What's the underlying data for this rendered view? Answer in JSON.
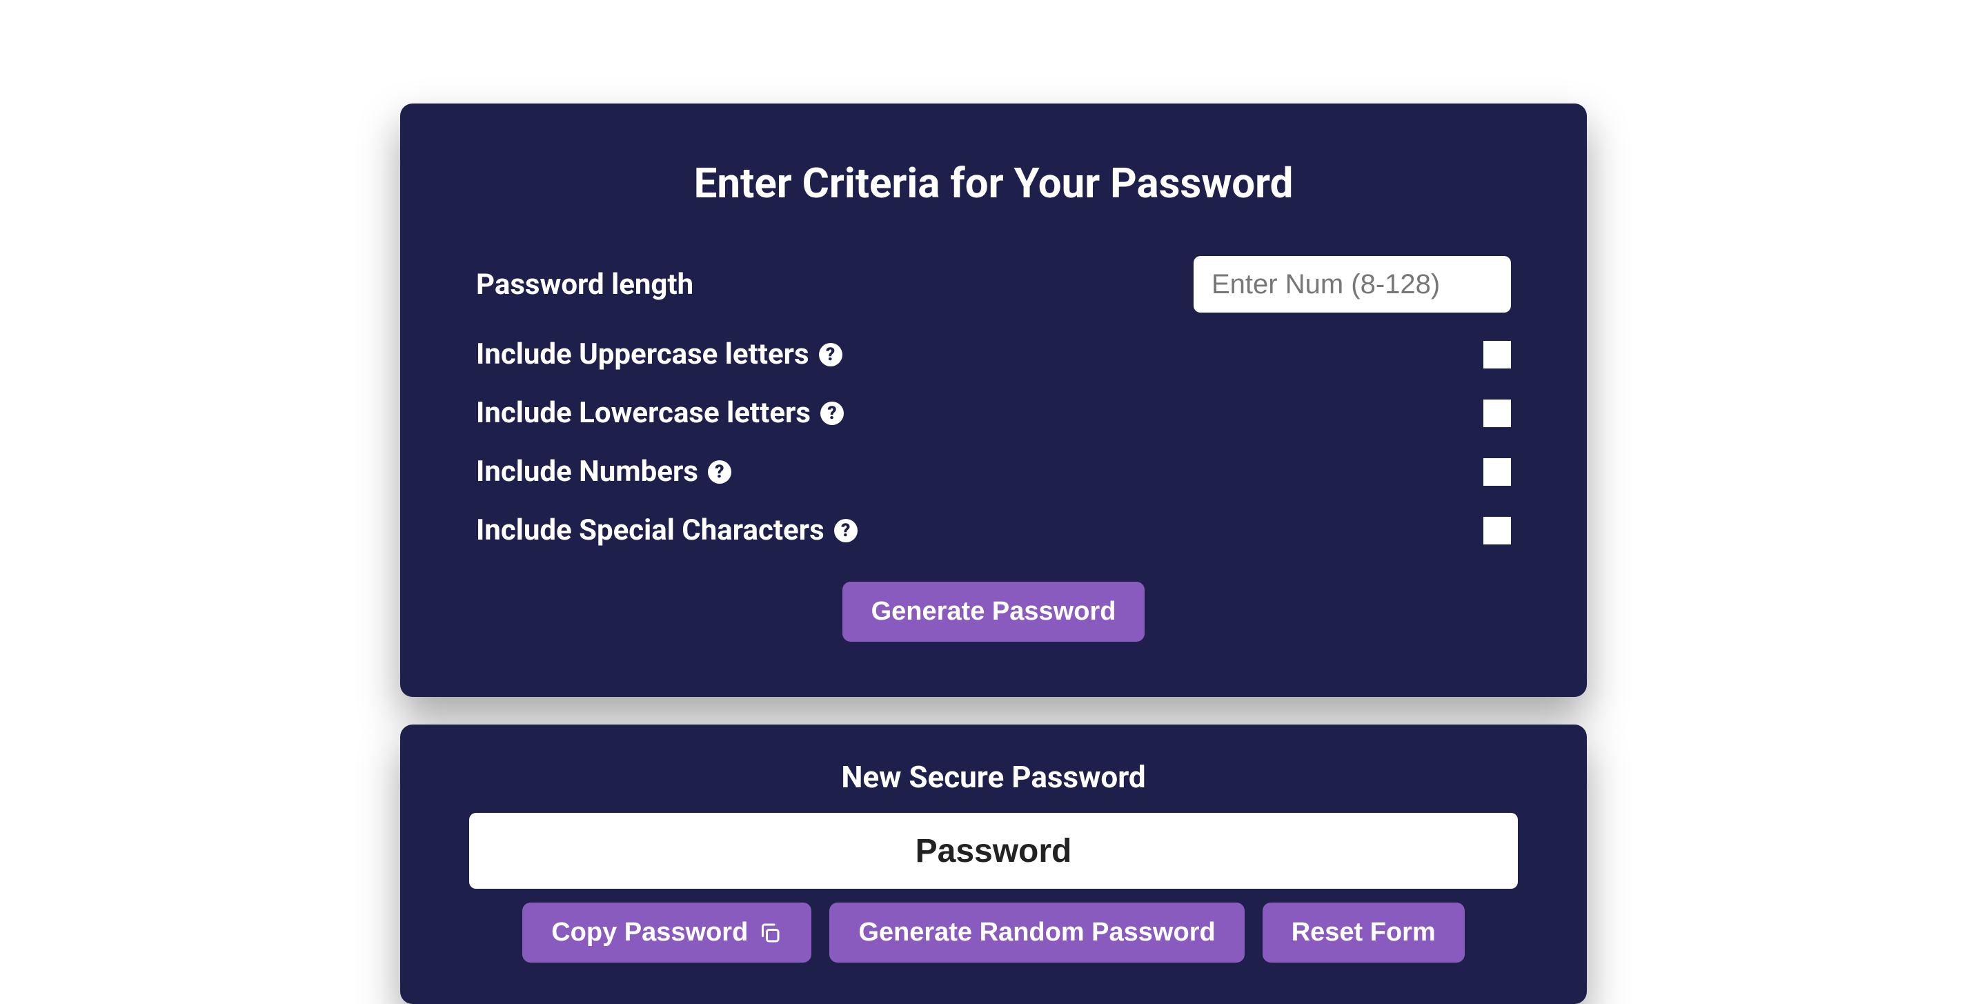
{
  "criteria": {
    "title": "Enter Criteria for Your Password",
    "length_label": "Password length",
    "length_placeholder": "Enter Num (8-128)",
    "uppercase_label": "Include Uppercase letters",
    "lowercase_label": "Include Lowercase letters",
    "numbers_label": "Include Numbers",
    "special_label": "Include Special Characters",
    "generate_button": "Generate Password"
  },
  "result": {
    "title": "New Secure Password",
    "output_placeholder": "Password",
    "copy_button": "Copy Password",
    "random_button": "Generate Random Password",
    "reset_button": "Reset Form"
  },
  "colors": {
    "card_bg": "#1e1f4a",
    "accent": "#8a5bbf"
  }
}
